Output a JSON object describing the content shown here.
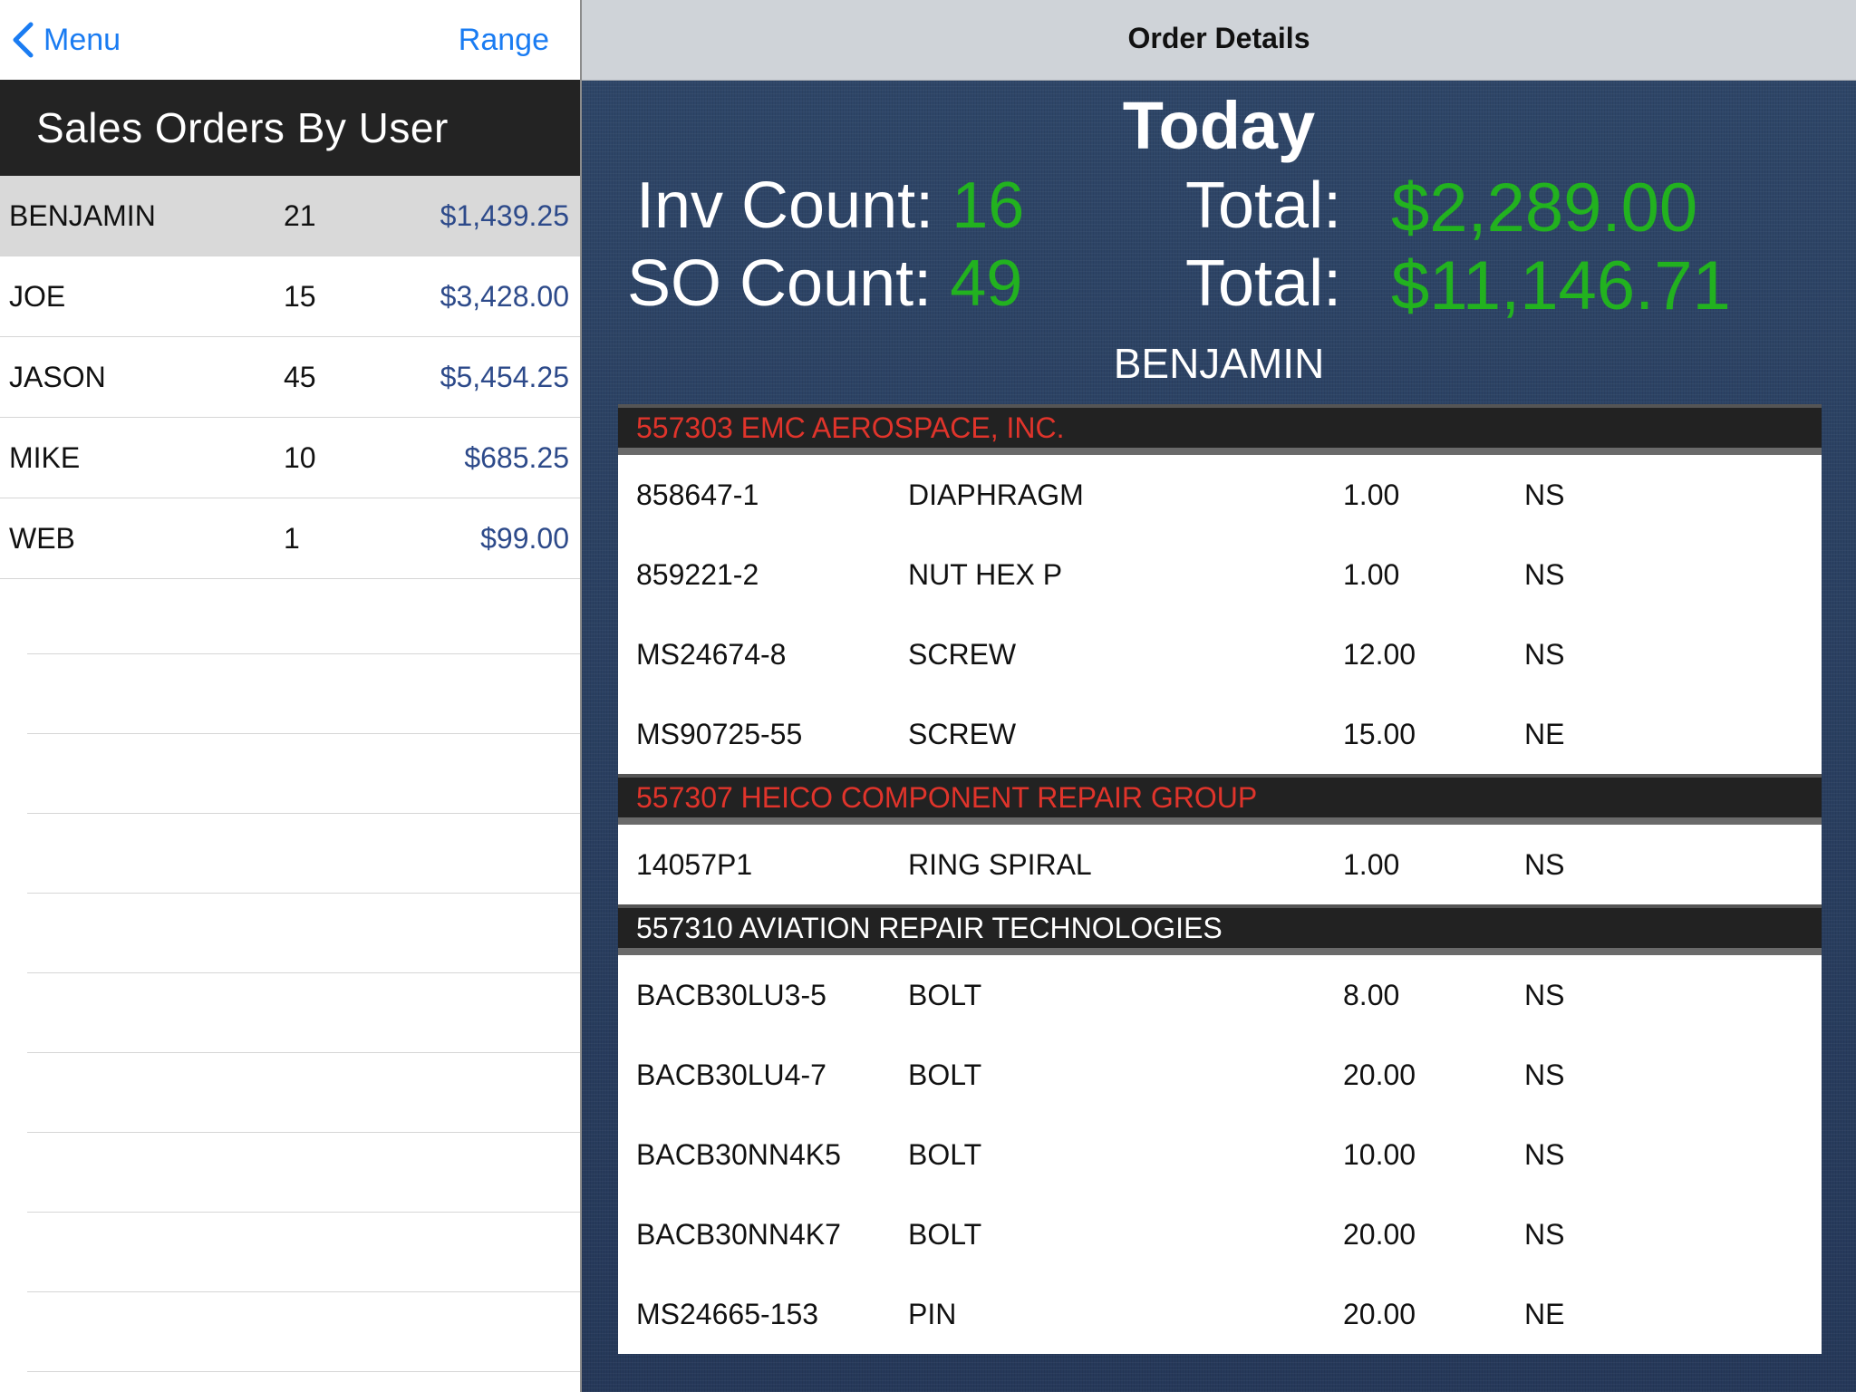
{
  "left_nav": {
    "back_label": "Menu",
    "range_label": "Range"
  },
  "left_header": {
    "title": "Sales Orders By User"
  },
  "users": [
    {
      "name": "BENJAMIN",
      "count": "21",
      "total": "$1,439.25"
    },
    {
      "name": "JOE",
      "count": "15",
      "total": "$3,428.00"
    },
    {
      "name": "JASON",
      "count": "45",
      "total": "$5,454.25"
    },
    {
      "name": "MIKE",
      "count": "10",
      "total": "$685.25"
    },
    {
      "name": "WEB",
      "count": "1",
      "total": "$99.00"
    }
  ],
  "detail": {
    "nav_title": "Order Details",
    "period": "Today",
    "inv_count_label": "Inv Count:",
    "inv_count": "16",
    "so_count_label": "SO Count:",
    "so_count": "49",
    "total_label": "Total:",
    "inv_total": "$2,289.00",
    "so_total": "$11,146.71",
    "selected_user": "BENJAMIN"
  },
  "orders": [
    {
      "header": "557303 EMC AEROSPACE, INC.",
      "header_color": "#e0342b",
      "lines": [
        {
          "part": "858647-1",
          "desc": "DIAPHRAGM",
          "qty": "1.00",
          "cond": "NS"
        },
        {
          "part": "859221-2",
          "desc": "NUT HEX P",
          "qty": "1.00",
          "cond": "NS"
        },
        {
          "part": "MS24674-8",
          "desc": "SCREW",
          "qty": "12.00",
          "cond": "NS"
        },
        {
          "part": "MS90725-55",
          "desc": "SCREW",
          "qty": "15.00",
          "cond": "NE"
        }
      ]
    },
    {
      "header": "557307 HEICO COMPONENT REPAIR GROUP",
      "header_color": "#e0342b",
      "lines": [
        {
          "part": "14057P1",
          "desc": "RING SPIRAL",
          "qty": "1.00",
          "cond": "NS"
        }
      ]
    },
    {
      "header": "557310 AVIATION REPAIR TECHNOLOGIES",
      "header_color": "#ffffff",
      "lines": [
        {
          "part": "BACB30LU3-5",
          "desc": "BOLT",
          "qty": "8.00",
          "cond": "NS"
        },
        {
          "part": "BACB30LU4-7",
          "desc": "BOLT",
          "qty": "20.00",
          "cond": "NS"
        },
        {
          "part": "BACB30NN4K5",
          "desc": "BOLT",
          "qty": "10.00",
          "cond": "NS"
        },
        {
          "part": "BACB30NN4K7",
          "desc": "BOLT",
          "qty": "20.00",
          "cond": "NS"
        },
        {
          "part": "MS24665-153",
          "desc": "PIN",
          "qty": "20.00",
          "cond": "NE"
        }
      ]
    }
  ],
  "colors": {
    "accent": "#1a7cf2",
    "money_green": "#22b21f",
    "list_money": "#2d4a8a",
    "selected_row": "#d9d9d9"
  },
  "icons": {
    "back": "chevron-left-icon"
  }
}
